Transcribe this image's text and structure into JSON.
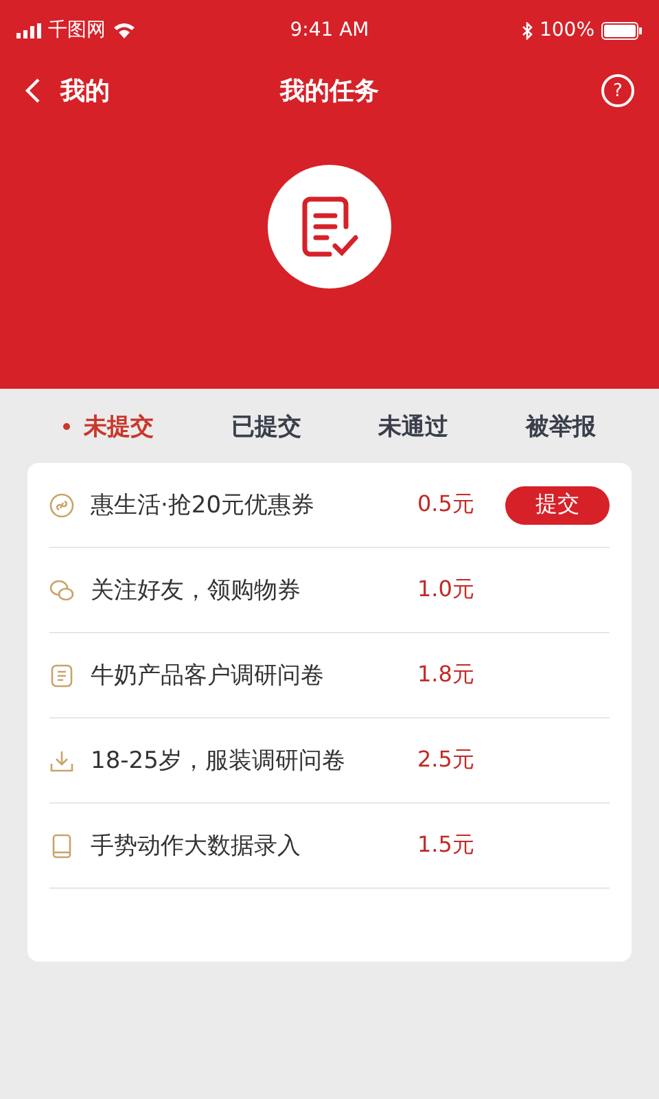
{
  "status_bar": {
    "carrier": "千图网",
    "time": "9:41 AM",
    "battery": "100%"
  },
  "nav": {
    "back": "我的",
    "title": "我的任务",
    "help": "?"
  },
  "tabs": [
    {
      "label": "未提交",
      "selected": true
    },
    {
      "label": "已提交",
      "selected": false
    },
    {
      "label": "未通过",
      "selected": false
    },
    {
      "label": "被举报",
      "selected": false
    }
  ],
  "tasks": [
    {
      "kind": "link",
      "title": "惠生活·抢20元优惠券",
      "reward": "0.5元",
      "action": "提交"
    },
    {
      "kind": "chat",
      "title": "关注好友，领购物券",
      "reward": "1.0元"
    },
    {
      "kind": "doc",
      "title": "牛奶产品客户调研问卷",
      "reward": "1.8元"
    },
    {
      "kind": "download",
      "title": "18-25岁，服装调研问卷",
      "reward": "2.5元"
    },
    {
      "kind": "phone",
      "title": "手势动作大数据录入",
      "reward": "1.5元"
    }
  ]
}
